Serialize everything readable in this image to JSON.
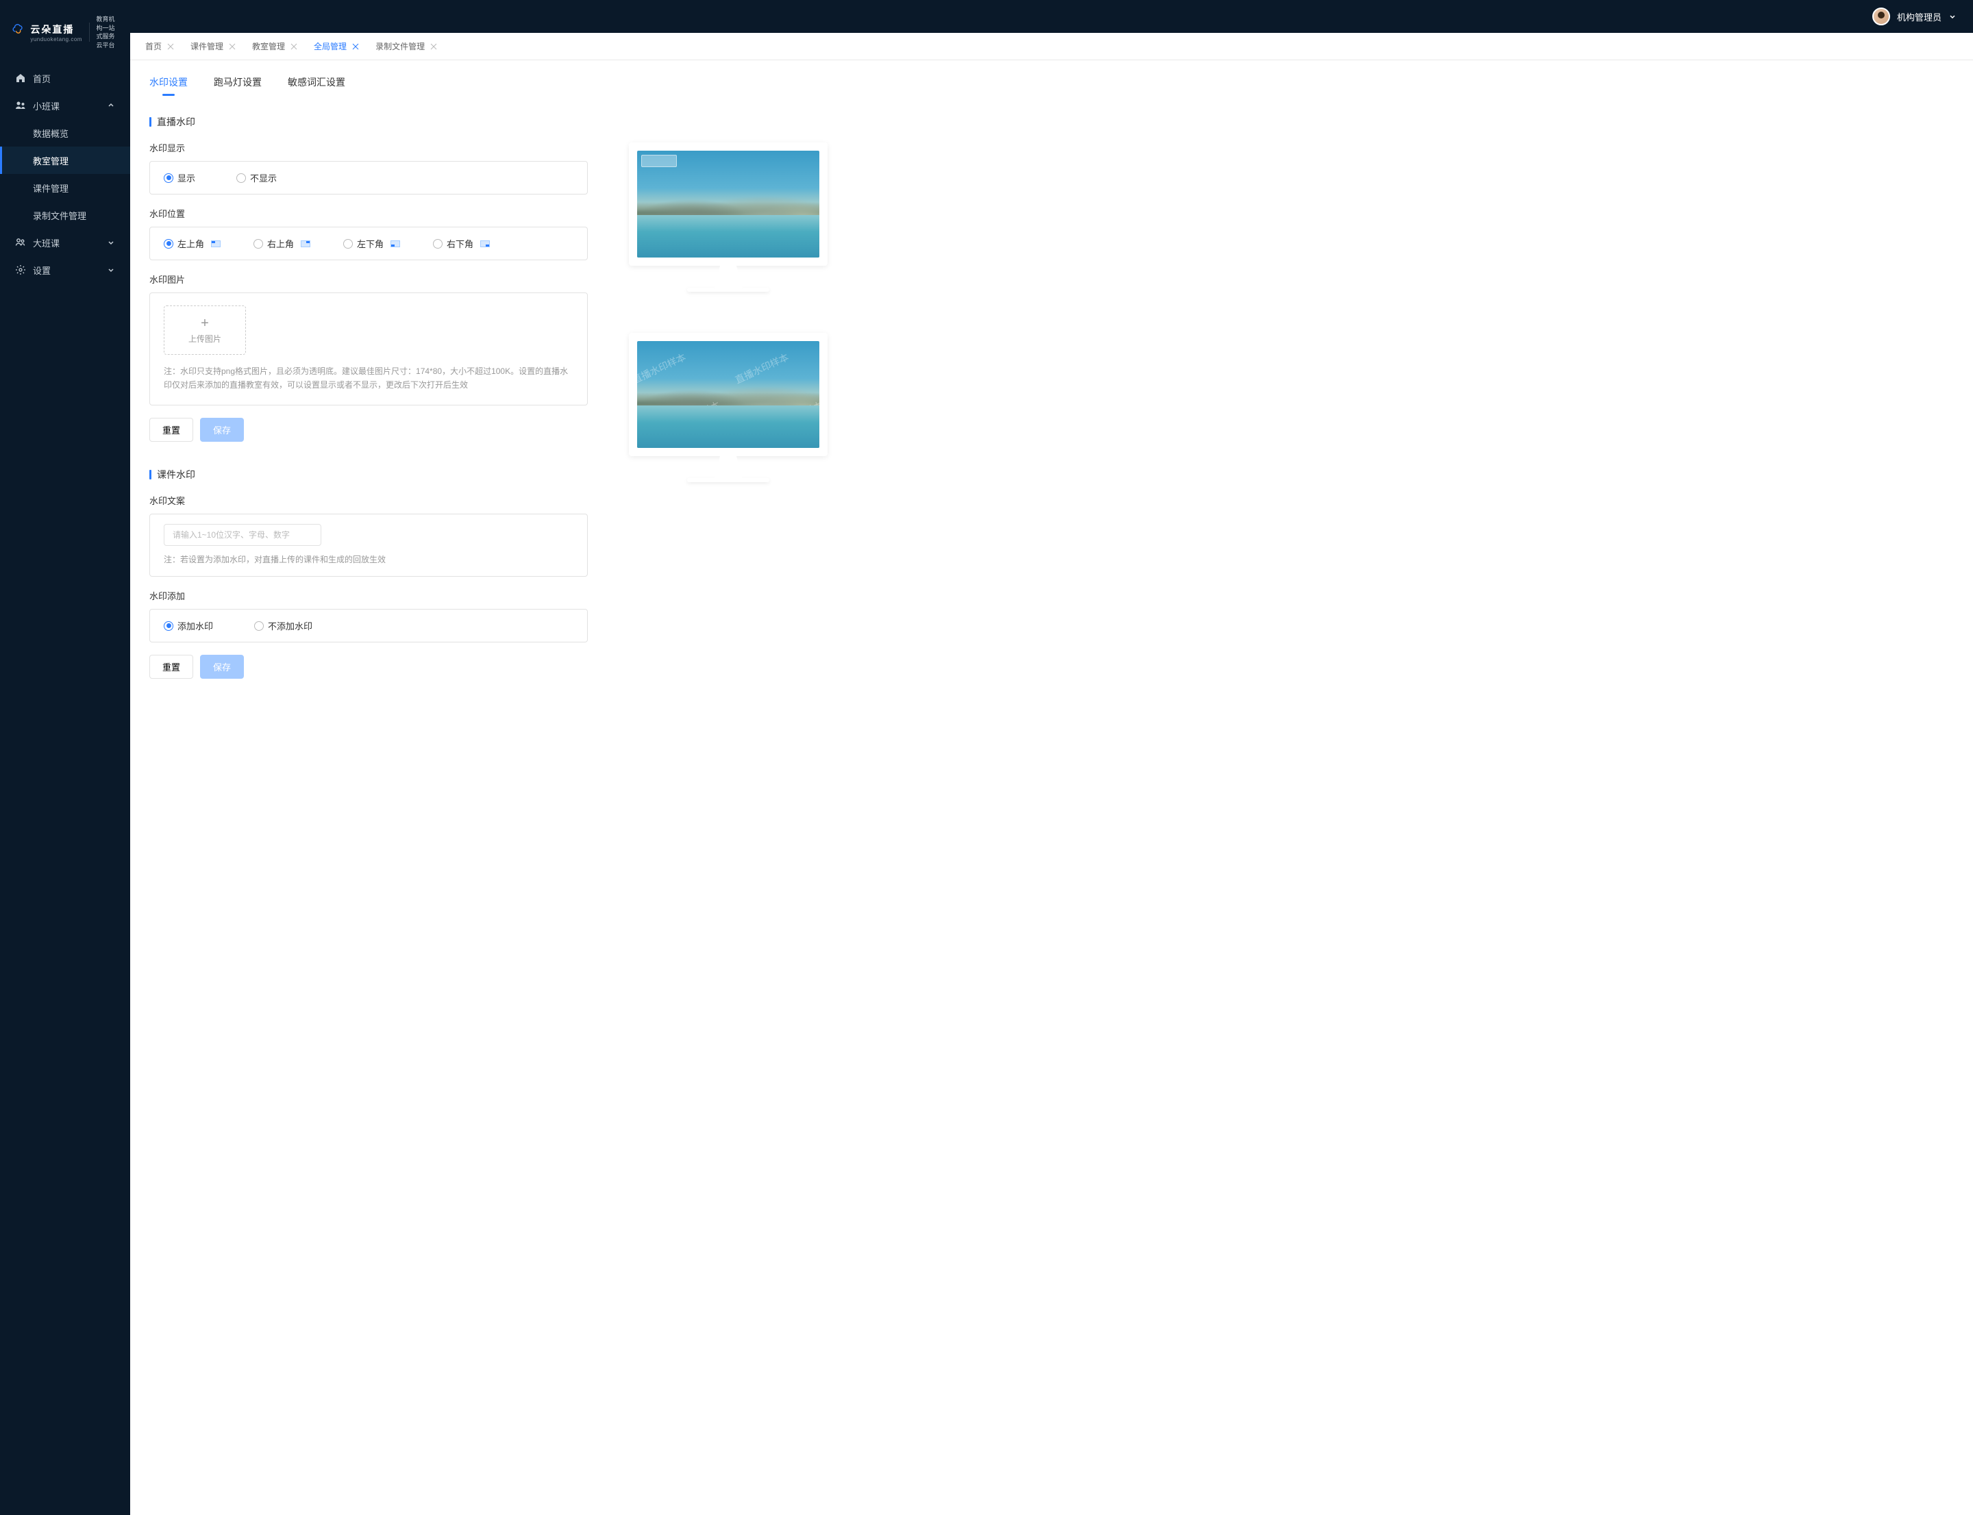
{
  "logo": {
    "main": "云朵直播",
    "sub": "yunduoketang.com",
    "slogan1": "教育机构一站",
    "slogan2": "式服务云平台"
  },
  "user": {
    "name": "机构管理员"
  },
  "sidebar": [
    {
      "label": "首页",
      "icon": "home"
    },
    {
      "label": "小班课",
      "icon": "users",
      "expanded": true,
      "children": [
        {
          "label": "数据概览"
        },
        {
          "label": "教室管理",
          "active": true
        },
        {
          "label": "课件管理"
        },
        {
          "label": "录制文件管理"
        }
      ]
    },
    {
      "label": "大班课",
      "icon": "users2"
    },
    {
      "label": "设置",
      "icon": "gear"
    }
  ],
  "tabs": [
    {
      "label": "首页"
    },
    {
      "label": "课件管理"
    },
    {
      "label": "教室管理"
    },
    {
      "label": "全局管理",
      "active": true
    },
    {
      "label": "录制文件管理"
    }
  ],
  "inner_tabs": [
    {
      "label": "水印设置",
      "active": true
    },
    {
      "label": "跑马灯设置"
    },
    {
      "label": "敏感词汇设置"
    }
  ],
  "section1": {
    "title": "直播水印",
    "display": {
      "label": "水印显示",
      "opt1": "显示",
      "opt2": "不显示"
    },
    "position": {
      "label": "水印位置",
      "tl": "左上角",
      "tr": "右上角",
      "bl": "左下角",
      "br": "右下角"
    },
    "image": {
      "label": "水印图片",
      "upload": "上传图片",
      "note": "注：水印只支持png格式图片，且必须为透明底。建议最佳图片尺寸：174*80，大小不超过100K。设置的直播水印仅对后来添加的直播教室有效，可以设置显示或者不显示，更改后下次打开后生效"
    },
    "btns": {
      "reset": "重置",
      "save": "保存"
    }
  },
  "section2": {
    "title": "课件水印",
    "text": {
      "label": "水印文案",
      "placeholder": "请输入1~10位汉字、字母、数字",
      "note": "注：若设置为添加水印，对直播上传的课件和生成的回放生效"
    },
    "add": {
      "label": "水印添加",
      "opt1": "添加水印",
      "opt2": "不添加水印"
    },
    "btns": {
      "reset": "重置",
      "save": "保存"
    }
  },
  "preview_wm": "直播水印样本"
}
